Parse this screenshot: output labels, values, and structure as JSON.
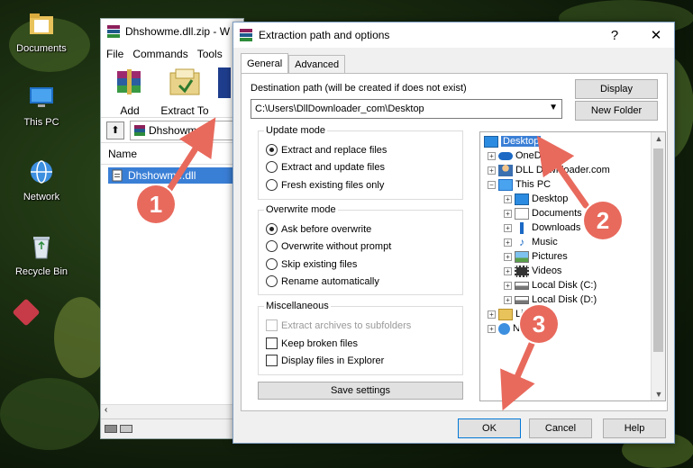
{
  "desktop": {
    "icons": [
      {
        "label": "Documents"
      },
      {
        "label": "This PC"
      },
      {
        "label": "Network"
      },
      {
        "label": "Recycle Bin"
      }
    ]
  },
  "winrar": {
    "title": "Dhshowme.dll.zip - W",
    "menu": [
      "File",
      "Commands",
      "Tools"
    ],
    "toolbar": {
      "add_label": "Add",
      "extract_label": "Extract To"
    },
    "path_text": "Dhshowme",
    "list_header": "Name",
    "file_name": "Dhshowme.dll"
  },
  "dialog": {
    "title": "Extraction path and options",
    "help_glyph": "?",
    "close_glyph": "✕",
    "tabs": [
      "General",
      "Advanced"
    ],
    "dest_label": "Destination path (will be created if does not exist)",
    "dest_value": "C:\\Users\\DllDownloader_com\\Desktop",
    "display_button": "Display",
    "new_folder_button": "New Folder",
    "update_mode": {
      "title": "Update mode",
      "options": [
        "Extract and replace files",
        "Extract and update files",
        "Fresh existing files only"
      ],
      "selected": 0
    },
    "overwrite_mode": {
      "title": "Overwrite mode",
      "options": [
        "Ask before overwrite",
        "Overwrite without prompt",
        "Skip existing files",
        "Rename automatically"
      ],
      "selected": 0
    },
    "misc": {
      "title": "Miscellaneous",
      "options": [
        "Extract archives to subfolders",
        "Keep broken files",
        "Display files in Explorer"
      ]
    },
    "save_settings": "Save settings",
    "tree": [
      {
        "label": "Desktop"
      },
      {
        "label": "OneDrive"
      },
      {
        "label": "DLL Downloader.com"
      },
      {
        "label": "This PC"
      },
      {
        "label": "Desktop"
      },
      {
        "label": "Documents"
      },
      {
        "label": "Downloads"
      },
      {
        "label": "Music"
      },
      {
        "label": "Pictures"
      },
      {
        "label": "Videos"
      },
      {
        "label": "Local Disk (C:)"
      },
      {
        "label": "Local Disk (D:)"
      },
      {
        "label": "Libra"
      },
      {
        "label": "Net"
      }
    ],
    "ok_button": "OK",
    "cancel_button": "Cancel",
    "help_button": "Help"
  },
  "annotations": [
    "1",
    "2",
    "3"
  ],
  "colors": {
    "arrow": "#e86a5d",
    "selection": "#3a7fd6"
  }
}
